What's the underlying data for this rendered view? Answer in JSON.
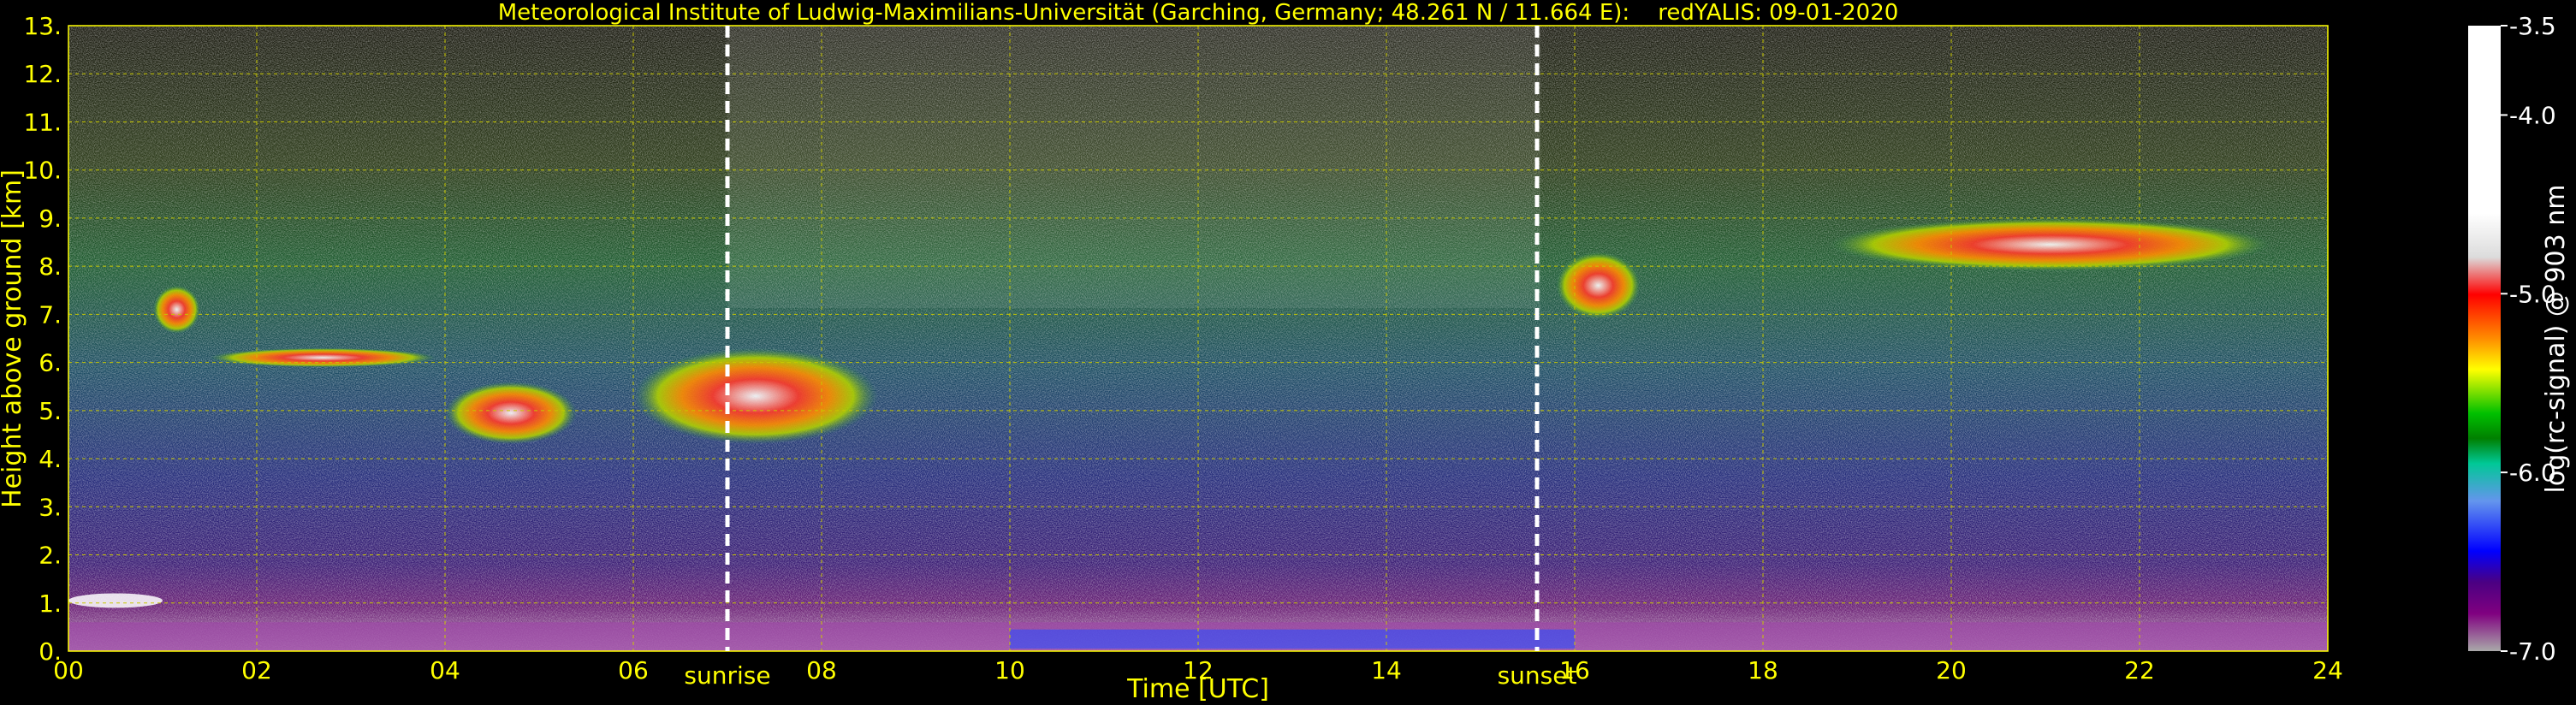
{
  "chart_data": {
    "type": "heatmap",
    "title": "Meteorological Institute of Ludwig-Maximilians-Universität (Garching, Germany; 48.261 N / 11.664 E):    redYALIS: 09-01-2020",
    "xlabel": "Time [UTC]",
    "ylabel": "Height above ground [km]",
    "xlim": [
      0,
      24
    ],
    "ylim": [
      0,
      13
    ],
    "x_ticks": [
      "00",
      "02",
      "04",
      "06",
      "08",
      "10",
      "12",
      "14",
      "16",
      "18",
      "20",
      "22",
      "24"
    ],
    "y_ticks": [
      "0.",
      "1.",
      "2.",
      "3.",
      "4.",
      "5.",
      "6.",
      "7.",
      "8.",
      "9.",
      "10.",
      "11.",
      "12.",
      "13."
    ],
    "grid": true,
    "annotations": [
      {
        "label": "sunrise",
        "x": 7.0
      },
      {
        "label": "sunset",
        "x": 15.6
      }
    ],
    "colorbar": {
      "label": "log(rc-signal) @ 903 nm",
      "range": [
        -7.0,
        -3.5
      ],
      "ticks": [
        "-3.5",
        "-4.0",
        "-5.0",
        "-6.0",
        "-7.0"
      ],
      "tick_values": [
        -3.5,
        -4.0,
        -5.0,
        -6.0,
        -7.0
      ],
      "colors": [
        "#ffffff",
        "#dcdcdc",
        "#ff0000",
        "#ff8c00",
        "#ffff00",
        "#00c000",
        "#008000",
        "#00ff7f",
        "#6495ed",
        "#0000ff",
        "#4b0082",
        "#800080",
        "#a9a9a9"
      ]
    },
    "features": [
      {
        "kind": "cloud",
        "x": [
          0.9,
          1.4
        ],
        "y": [
          6.6,
          7.6
        ]
      },
      {
        "kind": "cloud",
        "x": [
          1.5,
          3.9
        ],
        "y": [
          5.9,
          6.3
        ]
      },
      {
        "kind": "cloud",
        "x": [
          4.0,
          5.4
        ],
        "y": [
          4.3,
          5.6
        ]
      },
      {
        "kind": "cloud",
        "x": [
          6.0,
          8.6
        ],
        "y": [
          4.3,
          6.3
        ]
      },
      {
        "kind": "cloud",
        "x": [
          15.8,
          16.7
        ],
        "y": [
          6.9,
          8.3
        ]
      },
      {
        "kind": "cloud",
        "x": [
          18.7,
          23.4
        ],
        "y": [
          7.9,
          9.0
        ]
      },
      {
        "kind": "low_cloud",
        "x": [
          0.0,
          1.0
        ],
        "y": [
          0.9,
          1.2
        ]
      },
      {
        "kind": "boundary_layer",
        "x": [
          0.0,
          24.0
        ],
        "y": [
          0.0,
          0.6
        ]
      }
    ]
  }
}
